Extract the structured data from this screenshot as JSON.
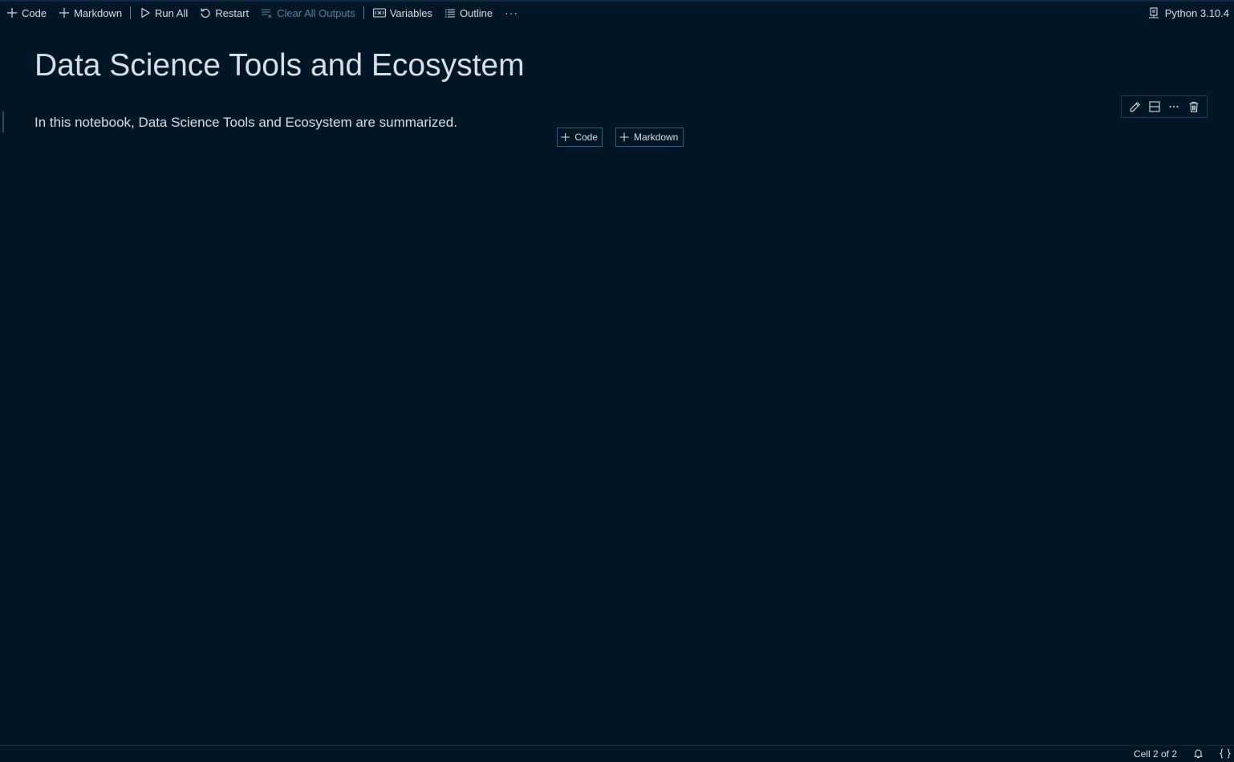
{
  "toolbar": {
    "code_label": "Code",
    "markdown_label": "Markdown",
    "run_all_label": "Run All",
    "restart_label": "Restart",
    "clear_outputs_label": "Clear All Outputs",
    "variables_label": "Variables",
    "outline_label": "Outline",
    "more_label": "···",
    "kernel_label": "Python 3.10.4"
  },
  "cells": {
    "title": "Data Science Tools and Ecosystem",
    "intro": "In this notebook, Data Science Tools and Ecosystem are summarized."
  },
  "cell_toolbar": {
    "icons": [
      "pencil-icon",
      "split-cell-icon",
      "more-icon",
      "trash-icon"
    ]
  },
  "insert": {
    "code_label": "Code",
    "markdown_label": "Markdown"
  },
  "statusbar": {
    "cell_position": "Cell 2 of 2"
  },
  "colors": {
    "background": "#011627",
    "text": "#d6deeb",
    "muted": "#5f7e97",
    "border": "#1d3b53"
  }
}
